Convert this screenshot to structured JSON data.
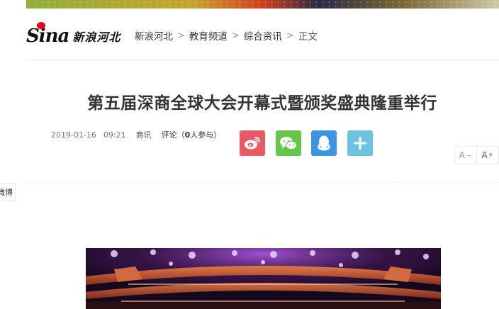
{
  "logo": {
    "mark": "Sina",
    "text": "新浪河北"
  },
  "breadcrumb": {
    "items": [
      {
        "label": "新浪河北"
      },
      {
        "label": "教育频道"
      },
      {
        "label": "综合资讯"
      }
    ],
    "current": "正文",
    "separator": ">"
  },
  "article": {
    "title": "第五届深商全球大会开幕式暨颁奖盛典隆重举行",
    "date": "2019-01-16",
    "time": "09:21",
    "source": "商讯",
    "comment_prefix": "评论（",
    "comment_count": "0",
    "comment_suffix": "人参与）"
  },
  "share": {
    "weibo_icon": "weibo-icon",
    "wechat_icon": "wechat-icon",
    "qq_icon": "qq-icon",
    "more_icon": "plus-icon",
    "colors": {
      "weibo": "#e85b66",
      "wechat": "#65c647",
      "qq": "#3d94e0",
      "more": "#6cc3e0"
    }
  },
  "font_size": {
    "decrease": "A",
    "decrease_sign": "－",
    "increase": "A",
    "increase_sign": "+"
  },
  "side_tab": {
    "label": "微博"
  },
  "colors": {
    "sina_red": "#e40a16"
  }
}
